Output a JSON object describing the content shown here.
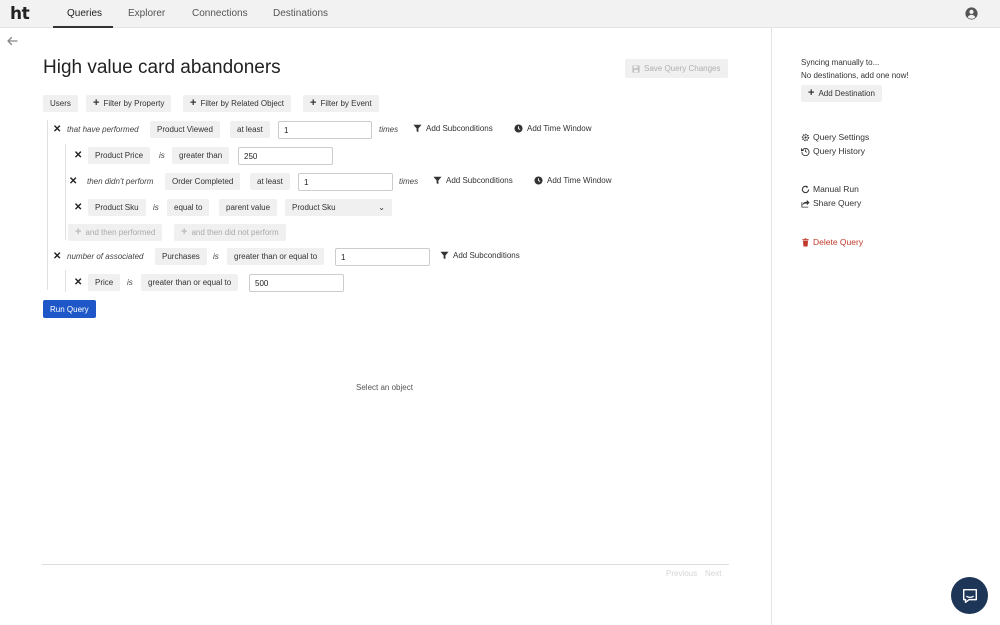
{
  "nav": {
    "logo": "ht",
    "tabs": [
      {
        "label": "Queries",
        "active": true
      },
      {
        "label": "Explorer",
        "active": false
      },
      {
        "label": "Connections",
        "active": false
      },
      {
        "label": "Destinations",
        "active": false
      }
    ]
  },
  "query": {
    "title": "High value card abandoners",
    "save_label": "Save Query Changes",
    "run_label": "Run Query",
    "empty_message": "Select an object",
    "pagination": {
      "previous": "Previous",
      "next": "Next"
    }
  },
  "filters": {
    "object": "Users",
    "by_property": "Filter by Property",
    "by_related": "Filter by Related Object",
    "by_event": "Filter by Event"
  },
  "conditions": {
    "c1": {
      "prefix": "that have performed",
      "event": "Product Viewed",
      "operator": "at least",
      "value": "1",
      "suffix": "times",
      "add_sub": "Add Subconditions",
      "add_time": "Add Time Window"
    },
    "c1_sub": {
      "property": "Product Price",
      "is": "is",
      "operator": "greater than",
      "value": "250"
    },
    "c2": {
      "prefix": "then didn't perform",
      "event": "Order Completed",
      "operator": "at least",
      "value": "1",
      "suffix": "times",
      "add_sub": "Add Subconditions",
      "add_time": "Add Time Window"
    },
    "c2_sub": {
      "property": "Product Sku",
      "is": "is",
      "operator": "equal to",
      "mode": "parent value",
      "value": "Product Sku"
    },
    "then_performed": "and then performed",
    "then_not_performed": "and then did not perform",
    "c3": {
      "prefix": "number of associated",
      "object": "Purchases",
      "is": "is",
      "operator": "greater than or equal to",
      "value": "1",
      "add_sub": "Add Subconditions"
    },
    "c3_sub": {
      "property": "Price",
      "is": "is",
      "operator": "greater than or equal to",
      "value": "500"
    }
  },
  "sidebar": {
    "sync_line1": "Syncing manually to...",
    "sync_line2": "No destinations, add one now!",
    "add_destination": "Add Destination",
    "query_settings": "Query Settings",
    "query_history": "Query History",
    "manual_run": "Manual Run",
    "share_query": "Share Query",
    "delete_query": "Delete Query"
  },
  "colors": {
    "primary": "#1f57c9",
    "danger": "#c0392b",
    "chat": "#1d3557"
  }
}
